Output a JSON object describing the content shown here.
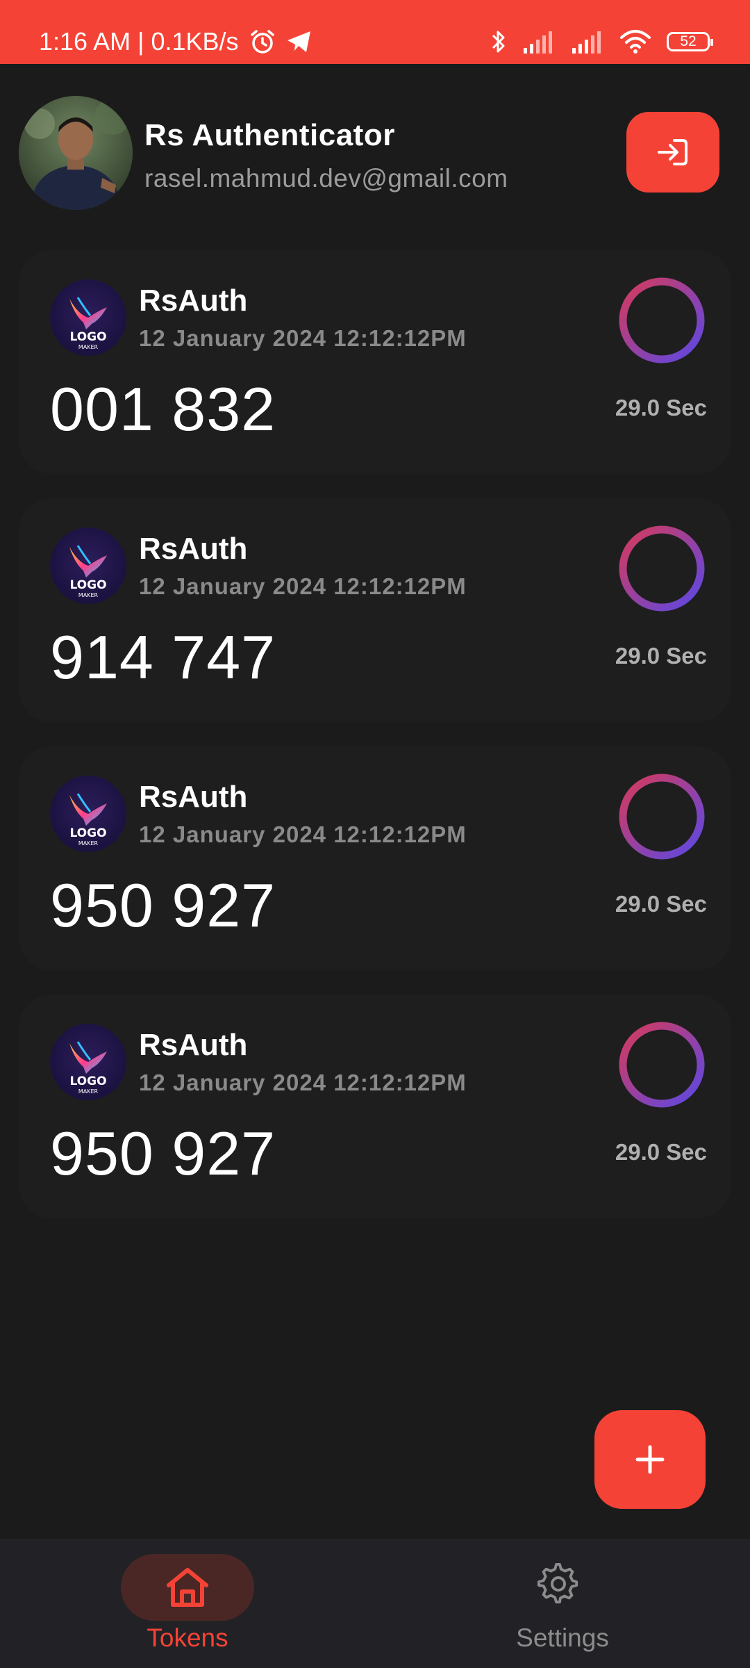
{
  "status_bar": {
    "time": "1:16 AM | 0.1KB/s",
    "battery": "52",
    "bg_color": "#f44336"
  },
  "header": {
    "title": "Rs Authenticator",
    "email": "rasel.mahmud.dev@gmail.com",
    "logout_icon": "login-arrow-icon"
  },
  "tokens": [
    {
      "issuer": "RsAuth",
      "date": "12 January 2024 12:12:12PM",
      "code": "001 832",
      "timer": "29.0 Sec",
      "logo_text": "LOGO",
      "logo_sub": "MAKER"
    },
    {
      "issuer": "RsAuth",
      "date": "12 January 2024 12:12:12PM",
      "code": "914 747",
      "timer": "29.0 Sec",
      "logo_text": "LOGO",
      "logo_sub": "MAKER"
    },
    {
      "issuer": "RsAuth",
      "date": "12 January 2024 12:12:12PM",
      "code": "950 927",
      "timer": "29.0 Sec",
      "logo_text": "LOGO",
      "logo_sub": "MAKER"
    },
    {
      "issuer": "RsAuth",
      "date": "12 January 2024 12:12:12PM",
      "code": "950 927",
      "timer": "29.0 Sec",
      "logo_text": "LOGO",
      "logo_sub": "MAKER"
    }
  ],
  "fab": {
    "icon": "plus-icon"
  },
  "bottom_nav": {
    "tokens_label": "Tokens",
    "settings_label": "Settings",
    "active": "Tokens"
  },
  "colors": {
    "accent": "#f44336",
    "background": "#1b1b1c",
    "card": "#1e1e1f",
    "ring_start": "#d63a5a",
    "ring_end": "#5a48e6"
  }
}
